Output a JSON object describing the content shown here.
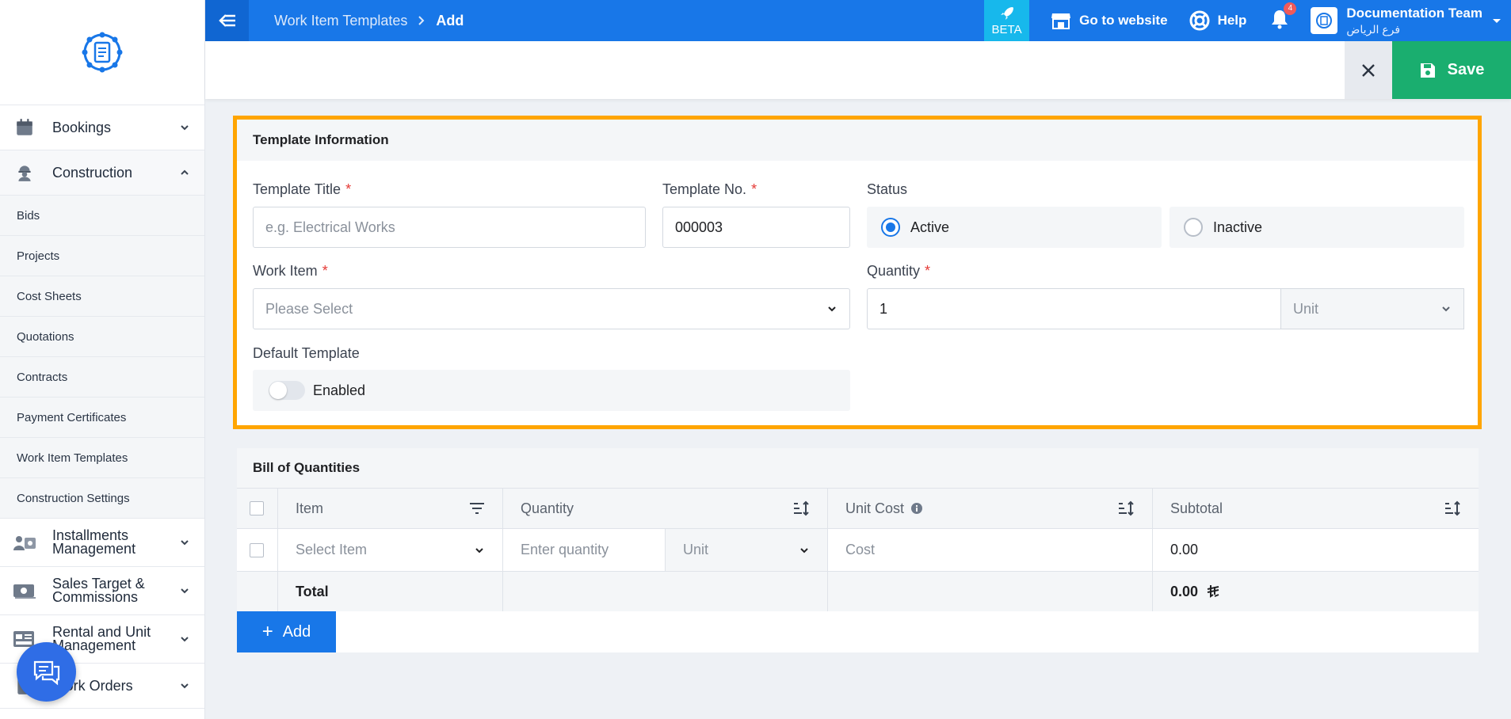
{
  "sidebar": {
    "groups": {
      "bookings": "Bookings",
      "construction": "Construction",
      "installments": "Installments Management",
      "sales": "Sales Target & Commissions",
      "rental": "Rental and Unit Management",
      "work_orders": "Work Orders"
    },
    "construction_items": [
      "Bids",
      "Projects",
      "Cost Sheets",
      "Quotations",
      "Contracts",
      "Payment Certificates",
      "Work Item Templates",
      "Construction Settings"
    ]
  },
  "topbar": {
    "breadcrumb_parent": "Work Item Templates",
    "breadcrumb_current": "Add",
    "beta_label": "BETA",
    "website_label": "Go to website",
    "help_label": "Help",
    "notification_count": "4",
    "account_name": "Documentation Team",
    "account_branch": "فرع الرياض"
  },
  "actions": {
    "save_label": "Save"
  },
  "template_info": {
    "heading": "Template Information",
    "title_label": "Template Title",
    "title_placeholder": "e.g. Electrical Works",
    "number_label": "Template No.",
    "number_value": "000003",
    "status_label": "Status",
    "status_active": "Active",
    "status_inactive": "Inactive",
    "work_item_label": "Work Item",
    "work_item_placeholder": "Please Select",
    "quantity_label": "Quantity",
    "quantity_value": "1",
    "unit_placeholder": "Unit",
    "default_label": "Default Template",
    "default_toggle_label": "Enabled"
  },
  "boq": {
    "heading": "Bill of Quantities",
    "columns": {
      "item": "Item",
      "quantity": "Quantity",
      "unit_cost": "Unit Cost",
      "subtotal": "Subtotal"
    },
    "row": {
      "item_placeholder": "Select Item",
      "quantity_placeholder": "Enter quantity",
      "unit_placeholder": "Unit",
      "cost_placeholder": "Cost",
      "subtotal": "0.00"
    },
    "total_label": "Total",
    "total_value": "0.00",
    "add_label": "Add"
  },
  "colors": {
    "primary": "#1877e8",
    "save": "#1aae6f",
    "highlight": "#ffa500"
  }
}
